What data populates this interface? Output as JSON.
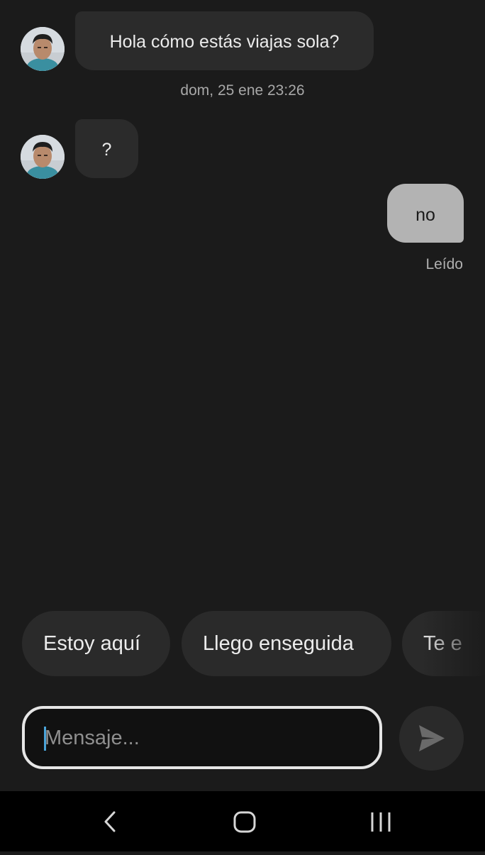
{
  "messages": [
    {
      "direction": "incoming",
      "text": "Hola cómo estás viajas sola?"
    },
    {
      "direction": "incoming",
      "text": "?"
    },
    {
      "direction": "outgoing",
      "text": "no"
    }
  ],
  "timestamp": "dom, 25 ene 23:26",
  "read_status": "Leído",
  "quick_replies": [
    "Estoy aquí",
    "Llego enseguida",
    "Te e"
  ],
  "composer": {
    "placeholder": "Mensaje...",
    "value": ""
  },
  "icons": {
    "send": "send-arrow-icon",
    "nav_back": "chevron-left-icon",
    "nav_home": "rounded-square-icon",
    "nav_recents": "three-bars-icon"
  },
  "colors": {
    "background": "#1b1b1b",
    "incoming_bubble": "#2b2b2b",
    "outgoing_bubble": "#b3b3b3",
    "caret": "#4aa3d8"
  }
}
